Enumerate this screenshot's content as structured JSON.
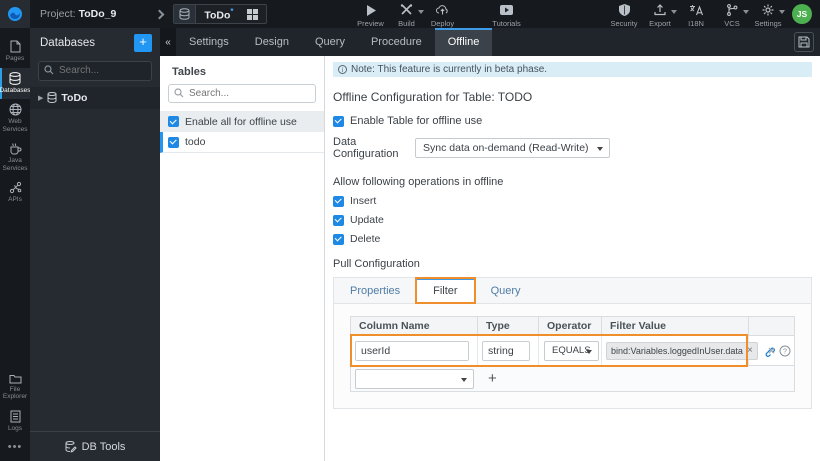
{
  "colors": {
    "accent_blue": "#2196f3",
    "tab_accent": "#3d9be8",
    "annotation_orange": "#ef8e2a",
    "avatar_green": "#4caf50",
    "notice_bg": "#d9edf7"
  },
  "topbar": {
    "project_prefix": "Project:",
    "project_name": "ToDo_9",
    "breadcrumb": {
      "entity": "ToDo",
      "modified_marker": "*"
    },
    "preview": {
      "label": "Preview",
      "icon": "play-icon"
    },
    "build": {
      "label": "Build",
      "icon": "tools-icon"
    },
    "deploy": {
      "label": "Deploy",
      "icon": "cloud-upload-icon"
    },
    "tutorials": {
      "label": "Tutorials",
      "icon": "video-icon"
    },
    "security": {
      "label": "Security",
      "icon": "shield-icon"
    },
    "export": {
      "label": "Export",
      "icon": "export-icon"
    },
    "i18n": {
      "label": "I18N",
      "icon": "translate-icon"
    },
    "vcs": {
      "label": "VCS",
      "icon": "branch-icon"
    },
    "settings": {
      "label": "Settings",
      "icon": "gear-icon"
    },
    "avatar_initials": "JS"
  },
  "left_rail": {
    "items": [
      {
        "label": "Pages",
        "icon": "page-icon"
      },
      {
        "label": "Databases",
        "icon": "database-icon",
        "active": true
      },
      {
        "label": "Web Services",
        "icon": "globe-icon"
      },
      {
        "label": "Java Services",
        "icon": "coffee-icon"
      },
      {
        "label": "APIs",
        "icon": "api-icon"
      }
    ],
    "bottom_items": [
      {
        "label": "File Explorer",
        "icon": "folder-icon"
      },
      {
        "label": "Logs",
        "icon": "log-icon"
      }
    ],
    "more_glyph": "•••"
  },
  "db_sidebar": {
    "title": "Databases",
    "add_button": "+",
    "collapse_button": "«",
    "search_placeholder": "Search...",
    "tree_caret": "▶",
    "items": [
      {
        "label": "ToDo"
      }
    ],
    "footer": "DB Tools"
  },
  "tab_bar": {
    "tabs": [
      "Settings",
      "Design",
      "Query",
      "Procedure",
      "Offline"
    ],
    "active_tab": "Offline"
  },
  "tables_panel": {
    "title": "Tables",
    "search_placeholder": "Search...",
    "enable_all_label": "Enable all for offline use",
    "tables": [
      {
        "name": "todo",
        "checked": true
      }
    ]
  },
  "main": {
    "notice_text": "Note: This feature is currently in beta phase.",
    "heading": "Offline Configuration for Table: TODO",
    "enable_table_label": "Enable Table for offline use",
    "data_config_label": "Data Configuration",
    "data_config_value": "Sync data on-demand (Read-Write)",
    "operations_heading": "Allow following operations in offline",
    "operations": [
      "Insert",
      "Update",
      "Delete"
    ],
    "pull_config_heading": "Pull Configuration",
    "pull_tabs": [
      "Properties",
      "Filter",
      "Query"
    ],
    "pull_active_tab": "Filter",
    "filter_table": {
      "headers": [
        "Column Name",
        "Type",
        "Operator",
        "Filter Value"
      ],
      "row": {
        "column_name": "userId",
        "type": "string",
        "operator": "EQUALS",
        "filter_value_chip": "bind:Variables.loggedInUser.data",
        "chip_remove": "×",
        "row_delete": "×"
      },
      "add_button": "+"
    }
  }
}
